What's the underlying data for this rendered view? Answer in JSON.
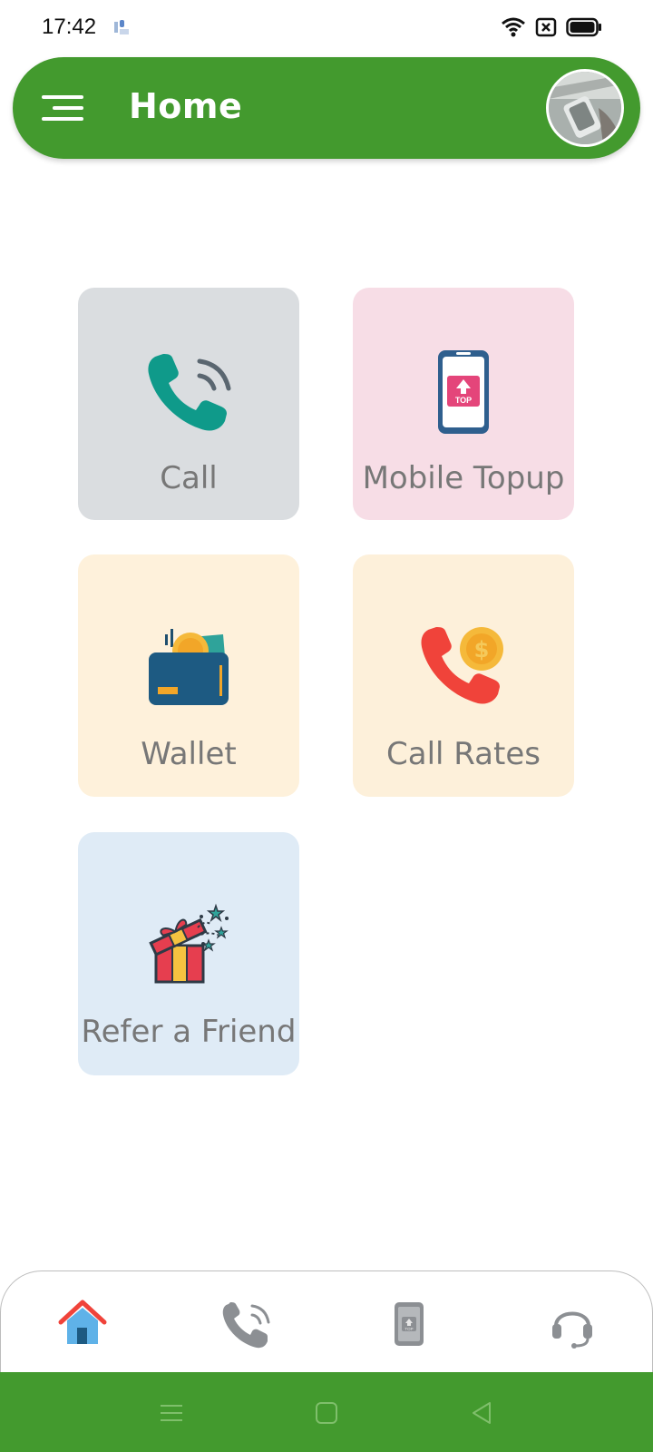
{
  "status_bar": {
    "time": "17:42",
    "icons": [
      "app-notification-icon",
      "wifi-icon",
      "sim-blocked-icon",
      "battery-icon"
    ]
  },
  "app_bar": {
    "title": "Home",
    "menu_icon": "hamburger-menu-icon",
    "avatar": "profile-avatar"
  },
  "tiles": [
    {
      "label": "Call",
      "icon": "phone-call-icon",
      "color": "#DADDE0"
    },
    {
      "label": "Mobile Topup",
      "icon": "mobile-topup-icon",
      "color": "#F7DDE6"
    },
    {
      "label": "Wallet",
      "icon": "wallet-icon",
      "color": "#FEF1DB"
    },
    {
      "label": "Call Rates",
      "icon": "call-rates-icon",
      "color": "#FDF0DA"
    },
    {
      "label": "Refer a Friend",
      "icon": "gift-box-icon",
      "color": "#DFEBF6"
    }
  ],
  "bottom_nav": {
    "items": [
      {
        "icon": "home-icon",
        "active": true
      },
      {
        "icon": "phone-icon",
        "active": false
      },
      {
        "icon": "mobile-icon",
        "active": false
      },
      {
        "icon": "headset-support-icon",
        "active": false
      }
    ]
  },
  "system_nav": [
    "recents-icon",
    "home-square-icon",
    "back-triangle-icon"
  ],
  "colors": {
    "brand_green": "#439A2E",
    "label_gray": "#777777",
    "call_teal": "#0F9A8A",
    "alert_red": "#F0433A",
    "topup_pink": "#E4457A",
    "wallet_blue": "#1D5A82"
  }
}
